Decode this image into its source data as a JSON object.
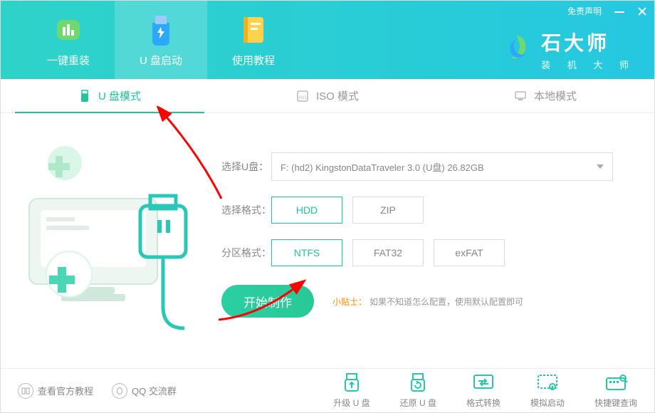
{
  "titlebar": {
    "disclaimer": "免责声明"
  },
  "brand": {
    "title": "石大师",
    "subtitle": "装 机 大 师"
  },
  "tabs": {
    "reinstall": "一键重装",
    "usb_boot": "U 盘启动",
    "tutorial": "使用教程"
  },
  "modes": {
    "usb": "U 盘模式",
    "iso": "ISO 模式",
    "local": "本地模式"
  },
  "form": {
    "select_disk_label": "选择U盘：",
    "select_disk_value": "F: (hd2) KingstonDataTraveler 3.0 (U盘) 26.82GB",
    "format_label": "选择格式：",
    "format_options": [
      "HDD",
      "ZIP"
    ],
    "format_selected": "HDD",
    "partition_label": "分区格式：",
    "partition_options": [
      "NTFS",
      "FAT32",
      "exFAT"
    ],
    "partition_selected": "NTFS",
    "primary_btn": "开始制作",
    "tip_label": "小贴士：",
    "tip_text": "如果不知道怎么配置，使用默认配置即可"
  },
  "footer": {
    "official_tutorial": "查看官方教程",
    "qq_group": "QQ 交流群",
    "tools": {
      "upgrade": "升级 U 盘",
      "restore": "还原 U 盘",
      "convert": "格式转换",
      "simulate": "模拟启动",
      "hotkey": "快捷键查询"
    }
  }
}
